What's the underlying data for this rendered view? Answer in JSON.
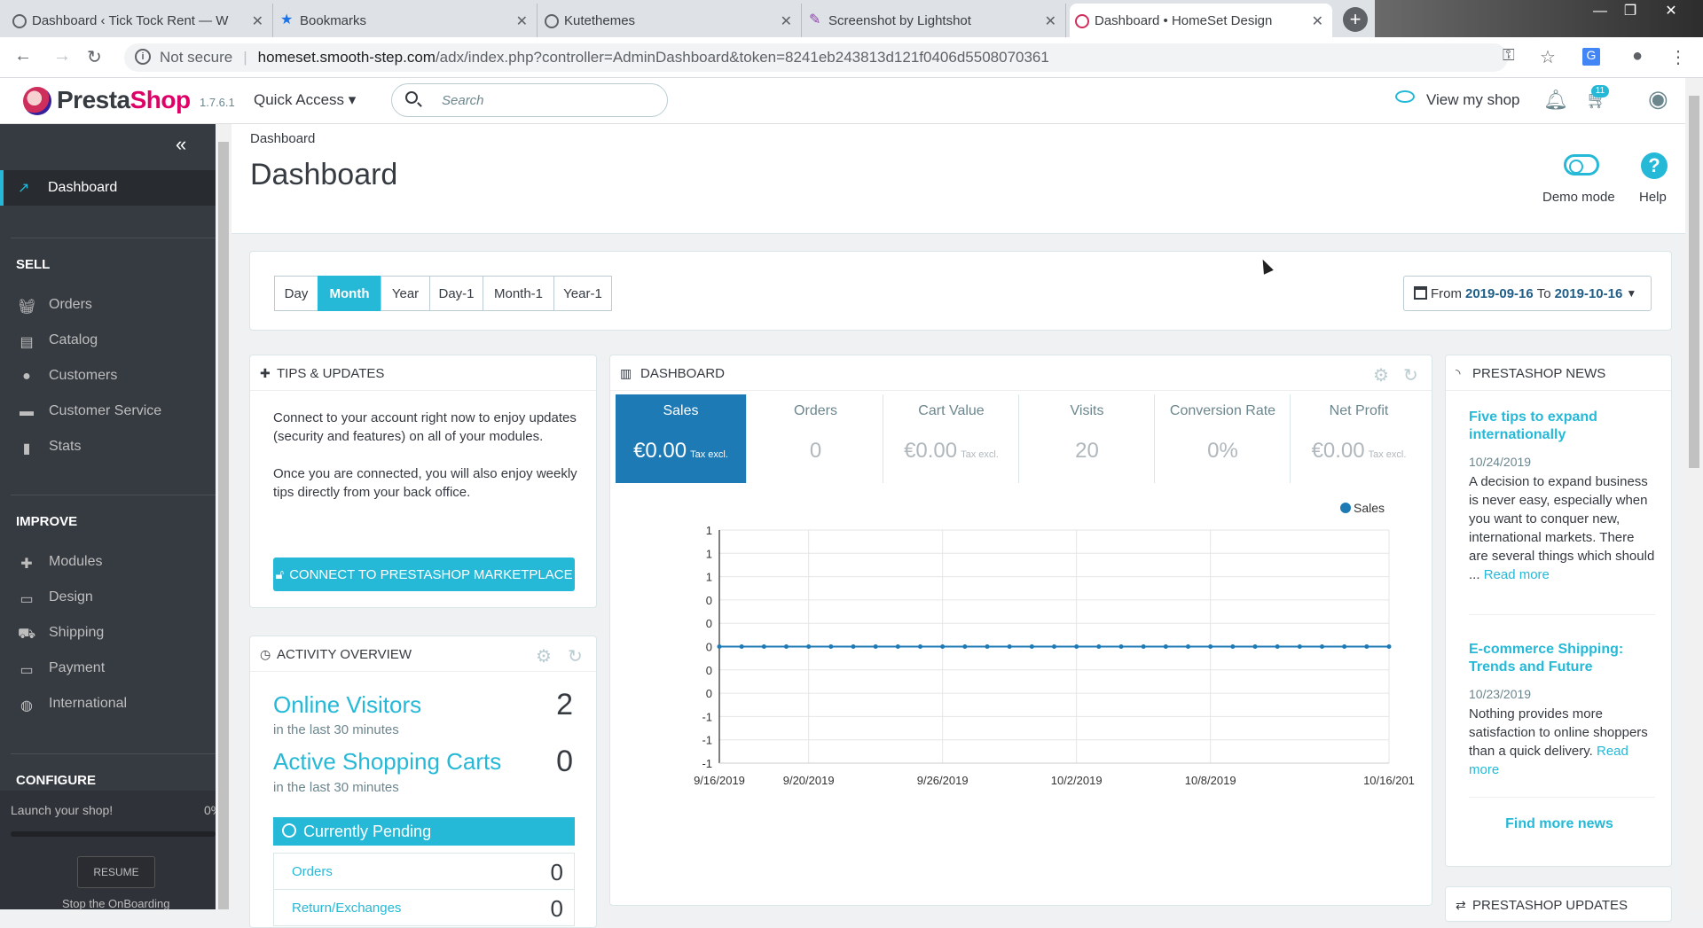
{
  "browser": {
    "tabs": [
      {
        "title": "Dashboard ‹ Tick Tock Rent — W",
        "active": false
      },
      {
        "title": "Bookmarks",
        "active": false
      },
      {
        "title": "Kutethemes",
        "active": false
      },
      {
        "title": "Screenshot by Lightshot",
        "active": false
      },
      {
        "title": "Dashboard • HomeSet Design",
        "active": true
      }
    ],
    "security": "Not secure",
    "url_host": "homeset.smooth-step.com",
    "url_path": "/adx/index.php?controller=AdminDashboard&token=8241eb243813d121f0406d5508070361"
  },
  "header": {
    "brand_pre": "Presta",
    "brand_post": "Shop",
    "version": "1.7.6.1",
    "quick_access": "Quick Access ▾",
    "search_placeholder": "Search",
    "view_shop": "View my shop",
    "cart_badge": "11"
  },
  "sidebar": {
    "dashboard": "Dashboard",
    "sell_heading": "SELL",
    "sell_items": [
      "Orders",
      "Catalog",
      "Customers",
      "Customer Service",
      "Stats"
    ],
    "improve_heading": "IMPROVE",
    "improve_items": [
      "Modules",
      "Design",
      "Shipping",
      "Payment",
      "International"
    ],
    "configure_heading": "CONFIGURE",
    "launch": "Launch your shop!",
    "launch_pct": "0%",
    "resume": "RESUME",
    "stop": "Stop the OnBoarding"
  },
  "page": {
    "breadcrumb": "Dashboard",
    "title": "Dashboard",
    "demo_mode": "Demo mode",
    "help": "Help"
  },
  "period": {
    "buttons": [
      "Day",
      "Month",
      "Year",
      "Day-1",
      "Month-1",
      "Year-1"
    ],
    "active": "Month",
    "from_label": "From",
    "from": "2019-09-16",
    "to_label": "To",
    "to": "2019-10-16"
  },
  "tips": {
    "heading": "TIPS & UPDATES",
    "text1": "Connect to your account right now to enjoy updates (security and features) on all of your modules.",
    "text2": "Once you are connected, you will also enjoy weekly tips directly from your back office.",
    "button": "CONNECT TO PRESTASHOP MARKETPLACE"
  },
  "activity": {
    "heading": "ACTIVITY OVERVIEW",
    "visitors_label": "Online Visitors",
    "visitors_value": "2",
    "visitors_sub": "in the last 30 minutes",
    "carts_label": "Active Shopping Carts",
    "carts_value": "0",
    "carts_sub": "in the last 30 minutes",
    "pending": "Currently Pending",
    "rows": [
      {
        "label": "Orders",
        "value": "0"
      },
      {
        "label": "Return/Exchanges",
        "value": "0"
      }
    ]
  },
  "dashboard": {
    "heading": "DASHBOARD",
    "kpis": [
      {
        "label": "Sales",
        "value": "€0.00",
        "suffix": "Tax excl."
      },
      {
        "label": "Orders",
        "value": "0",
        "suffix": ""
      },
      {
        "label": "Cart Value",
        "value": "€0.00",
        "suffix": "Tax excl."
      },
      {
        "label": "Visits",
        "value": "20",
        "suffix": ""
      },
      {
        "label": "Conversion Rate",
        "value": "0%",
        "suffix": ""
      },
      {
        "label": "Net Profit",
        "value": "€0.00",
        "suffix": "Tax excl."
      }
    ]
  },
  "chart_data": {
    "type": "line",
    "legend": "Sales",
    "legend_position": "top-right",
    "color": "#1e7ab5",
    "y_tick_labels": [
      "1",
      "1",
      "1",
      "0",
      "0",
      "0",
      "0",
      "0",
      "-1",
      "-1",
      "-1"
    ],
    "x_tick_labels": [
      "9/16/2019",
      "9/20/2019",
      "9/26/2019",
      "10/2/2019",
      "10/8/2019",
      "10/16/201"
    ],
    "x": [
      "9/16/2019",
      "9/17/2019",
      "9/18/2019",
      "9/19/2019",
      "9/20/2019",
      "9/21/2019",
      "9/22/2019",
      "9/23/2019",
      "9/24/2019",
      "9/25/2019",
      "9/26/2019",
      "9/27/2019",
      "9/28/2019",
      "9/29/2019",
      "9/30/2019",
      "10/1/2019",
      "10/2/2019",
      "10/3/2019",
      "10/4/2019",
      "10/5/2019",
      "10/6/2019",
      "10/7/2019",
      "10/8/2019",
      "10/9/2019",
      "10/10/2019",
      "10/11/2019",
      "10/12/2019",
      "10/13/2019",
      "10/14/2019",
      "10/15/2019",
      "10/16/2019"
    ],
    "values": [
      0,
      0,
      0,
      0,
      0,
      0,
      0,
      0,
      0,
      0,
      0,
      0,
      0,
      0,
      0,
      0,
      0,
      0,
      0,
      0,
      0,
      0,
      0,
      0,
      0,
      0,
      0,
      0,
      0,
      0,
      0
    ],
    "grid": true
  },
  "news": {
    "heading": "PRESTASHOP NEWS",
    "items": [
      {
        "title": "Five tips to expand internationally",
        "date": "10/24/2019",
        "text": "A decision to expand business is never easy, especially when you want to conquer new, international markets. There are several things which should ...",
        "more": "Read more"
      },
      {
        "title": "E-commerce Shipping: Trends and Future",
        "date": "10/23/2019",
        "text": "Nothing provides more satisfaction to online shoppers than a quick delivery.",
        "more": "Read more"
      }
    ],
    "find_more": "Find more news",
    "updates_heading": "PRESTASHOP UPDATES"
  }
}
